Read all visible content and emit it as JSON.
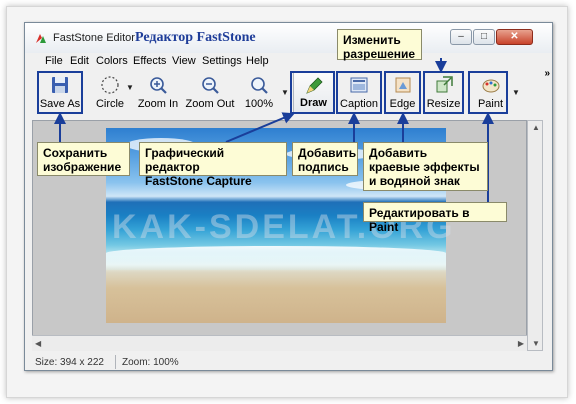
{
  "window": {
    "title": "FastStone Editor",
    "brand": "Редактор FastStone",
    "controls": [
      "–",
      "□",
      "✕"
    ]
  },
  "menu": [
    "File",
    "Edit",
    "Colors",
    "Effects",
    "View",
    "Settings",
    "Help"
  ],
  "toolbar": {
    "save_as": "Save As",
    "circle": "Circle",
    "zoom_in": "Zoom In",
    "zoom_out": "Zoom Out",
    "zoom_level": "100%",
    "draw": "Draw",
    "caption": "Caption",
    "edge": "Edge",
    "resize": "Resize",
    "paint": "Paint",
    "more": "»"
  },
  "canvas": {
    "watermark": "KAK-SDELAT.ORG"
  },
  "status": {
    "size": "Size: 394 x 222",
    "zoom": "Zoom: 100%"
  },
  "callouts": {
    "resize": "Изменить\nразрешение",
    "save": "Сохранить\nизображение",
    "draw": "Графический редактор\nFastStone Capture",
    "caption": "Добавить\nподпись",
    "edge": "Добавить\nкраевые эффекты\nи водяной знак",
    "paint": "Редактировать в Paint"
  },
  "colors": {
    "highlight": "#1a3e9a",
    "callout_bg": "#fdfcd6",
    "brand": "#1f3d99"
  }
}
